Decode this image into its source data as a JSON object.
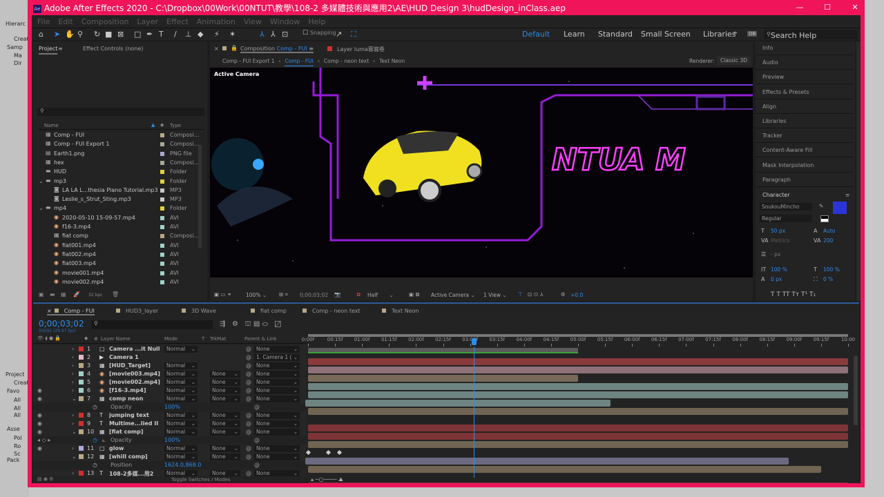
{
  "background_window": {
    "items": [
      "Hierarc",
      "Create",
      "Samp",
      "Ma",
      "Dir",
      "Project",
      "Create",
      "Favo",
      "All",
      "All",
      "All",
      "Asse",
      "Pol",
      "Ro",
      "Sc",
      "Pack"
    ]
  },
  "window": {
    "title": "Adobe After Effects 2020 - C:\\Dropbox\\00Work\\00NTUT\\教學\\108-2 多媒體技術與應用2\\AE\\HUD Design 3\\hudDesign_inClass.aep",
    "icon": "Ae",
    "minimize": "—",
    "maximize": "☐",
    "close": "✕"
  },
  "menu": [
    "File",
    "Edit",
    "Composition",
    "Layer",
    "Effect",
    "Animation",
    "View",
    "Window",
    "Help"
  ],
  "toolbar": {
    "snapping": "Snapping",
    "workspaces": [
      "Default",
      "Learn",
      "Standard",
      "Small Screen",
      "Libraries"
    ],
    "search_placeholder": "Search Help"
  },
  "project_panel": {
    "tabs": [
      "Project",
      "Effect Controls (none)"
    ],
    "columns": [
      "Name",
      "Type"
    ],
    "bpc": "32 bpc",
    "items": [
      {
        "name": "Comp - FUI",
        "type": "Composi...",
        "color": "#b8a888",
        "kind": "comp",
        "indent": 0
      },
      {
        "name": "Comp - FUI Export 1",
        "type": "Composi...",
        "color": "#a8a898",
        "kind": "comp",
        "indent": 0
      },
      {
        "name": "Earth1.png",
        "type": "PNG file",
        "color": "#a8a8d0",
        "kind": "file",
        "indent": 0
      },
      {
        "name": "hex",
        "type": "Composi...",
        "color": "#a8a898",
        "kind": "comp",
        "indent": 0
      },
      {
        "name": "HUD",
        "type": "Folder",
        "color": "#e0d040",
        "kind": "folder",
        "indent": 0
      },
      {
        "name": "mp3",
        "type": "Folder",
        "color": "#e0d040",
        "kind": "folder",
        "indent": 0
      },
      {
        "name": "LA LA L...thesia Piano Tutorial.mp3",
        "type": "MP3",
        "color": "#c8c8c8",
        "kind": "audio",
        "indent": 1
      },
      {
        "name": "Leslie_s_Strut_Sting.mp3",
        "type": "MP3",
        "color": "#c8c8c8",
        "kind": "audio",
        "indent": 1
      },
      {
        "name": "mp4",
        "type": "Folder",
        "color": "#e0d040",
        "kind": "folder",
        "indent": 0
      },
      {
        "name": "2020-05-10 15-09-57.mp4",
        "type": "AVI",
        "color": "#a0d0c8",
        "kind": "video",
        "indent": 1
      },
      {
        "name": "f16-3.mp4",
        "type": "AVI",
        "color": "#a0d0c8",
        "kind": "video",
        "indent": 1
      },
      {
        "name": "fiat comp",
        "type": "Composi...",
        "color": "#b8a888",
        "kind": "comp",
        "indent": 1
      },
      {
        "name": "fiat001.mp4",
        "type": "AVI",
        "color": "#a0d0c8",
        "kind": "video",
        "indent": 1
      },
      {
        "name": "fiat002.mp4",
        "type": "AVI",
        "color": "#a0d0c8",
        "kind": "video",
        "indent": 1
      },
      {
        "name": "fiat003.mp4",
        "type": "AVI",
        "color": "#a0d0c8",
        "kind": "video",
        "indent": 1
      },
      {
        "name": "movie001.mp4",
        "type": "AVI",
        "color": "#a0d0c8",
        "kind": "video",
        "indent": 1
      },
      {
        "name": "movie002.mp4",
        "type": "AVI",
        "color": "#a0d0c8",
        "kind": "video",
        "indent": 1
      }
    ]
  },
  "composition": {
    "tab_prefix": "Composition",
    "tab_name": "Comp - FUI",
    "layer_tab": "Layer luma蓉窩卷",
    "breadcrumbs": [
      "Comp - FUI Export 1",
      "Comp - FUI",
      "Comp - neon text",
      "Text Neon"
    ],
    "renderer_label": "Renderer:",
    "renderer": "Classic 3D",
    "camera_label": "Active Camera",
    "neon_text": "NTUA M",
    "footer": {
      "zoom": "100%",
      "timecode": "0;00;03;02",
      "resolution": "Half",
      "camera": "Active Camera",
      "views": "1 View",
      "exposure": "+0.0"
    }
  },
  "right_panels": [
    "Info",
    "Audio",
    "Preview",
    "Effects & Presets",
    "Align",
    "Libraries",
    "Tracker",
    "Content-Aware Fill",
    "Mask Interpolation",
    "Paragraph"
  ],
  "character": {
    "title": "Character",
    "font": "SoukouMincho",
    "style": "Regular",
    "size": "50 px",
    "leading": "Auto",
    "kerning": "Metrics",
    "tracking": "200",
    "stroke": "- px",
    "vscale": "100 %",
    "hscale": "100 %",
    "baseline": "0 px",
    "tsume": "0 %",
    "fill_color": "#2a35d8"
  },
  "timeline": {
    "tabs": [
      {
        "label": "Comp - FUI",
        "color": "#b8a888"
      },
      {
        "label": "HUD3_layer",
        "color": "#b8a888"
      },
      {
        "label": "3D Wave",
        "color": "#b8a888"
      },
      {
        "label": "fiat comp",
        "color": "#b8a888"
      },
      {
        "label": "Comp - neon text",
        "color": "#b8a888"
      },
      {
        "label": "Text Neon",
        "color": "#b8a888"
      }
    ],
    "timecode": "0;00;03;02",
    "fps": "00092 (29.97 fps)",
    "current_time": 3.07,
    "work_area_end": 5.0,
    "duration": 10,
    "columns": {
      "num": "#",
      "name": "Layer Name",
      "mode": "Mode",
      "t": "T",
      "trkmat": "TrkMat",
      "parent": "Parent & Link"
    },
    "ticks": [
      "0:00f",
      "00:15f",
      "01:00f",
      "01:15f",
      "02:00f",
      "02:15f",
      "03:00f",
      "03:15f",
      "04:00f",
      "04:15f",
      "05:00f",
      "05:15f",
      "06:00f",
      "06:15f",
      "07:00f",
      "07:15f",
      "08:00f",
      "08:15f",
      "09:00f",
      "09:15f",
      "10:00"
    ],
    "toggle_label": "Toggle Switches / Modes",
    "rows": [
      {
        "type": "layer",
        "num": "1",
        "name": "Camera ...it Null",
        "label": "#d03030",
        "mode": "Normal",
        "trkmat": "",
        "parent": "None",
        "eye": false,
        "open": false,
        "kind": "null",
        "start": 0,
        "end": 10,
        "bar": "#8a3a3c"
      },
      {
        "type": "layer",
        "num": "2",
        "name": "Camera 1",
        "label": "#e8b8c8",
        "mode": "",
        "trkmat": "",
        "parent": "1. Camera 1 (",
        "eye": false,
        "open": false,
        "kind": "camera",
        "start": 0,
        "end": 10,
        "bar": "#8e7078"
      },
      {
        "type": "layer",
        "num": "3",
        "name": "[HUD_Target]",
        "label": "#b8a888",
        "mode": "Normal",
        "trkmat": "",
        "parent": "None",
        "eye": false,
        "open": false,
        "kind": "comp",
        "start": 0,
        "end": 5,
        "bar": "#776a58"
      },
      {
        "type": "layer",
        "num": "4",
        "name": "[movie003.mp4]",
        "label": "#a0d0c8",
        "mode": "Normal",
        "trkmat": "None",
        "parent": "None",
        "eye": false,
        "open": false,
        "kind": "video",
        "start": 0,
        "end": 10,
        "bar": "#6e8482"
      },
      {
        "type": "layer",
        "num": "5",
        "name": "[movie002.mp4]",
        "label": "#a0d0c8",
        "mode": "Normal",
        "trkmat": "None",
        "parent": "None",
        "eye": false,
        "open": false,
        "kind": "video",
        "start": 0,
        "end": 10,
        "bar": "#6e8482"
      },
      {
        "type": "layer",
        "num": "6",
        "name": "[f16-3.mp4]",
        "label": "#a0d0c8",
        "mode": "Normal",
        "trkmat": "None",
        "parent": "None",
        "eye": true,
        "open": false,
        "kind": "video",
        "start": -0.1,
        "end": 5.6,
        "bar": "#6e8482"
      },
      {
        "type": "layer",
        "num": "7",
        "name": "comp neon",
        "label": "#b8a888",
        "mode": "Normal",
        "trkmat": "None",
        "parent": "None",
        "eye": true,
        "open": true,
        "kind": "comp",
        "start": 0,
        "end": 10,
        "bar": "#706452"
      },
      {
        "type": "prop",
        "name": "Opacity",
        "value": "100%",
        "keyframes": []
      },
      {
        "type": "layer",
        "num": "8",
        "name": "jumping text",
        "label": "#d03030",
        "mode": "Normal",
        "trkmat": "None",
        "parent": "None",
        "eye": true,
        "open": false,
        "kind": "text",
        "start": 0,
        "end": 10,
        "bar": "#7e3436"
      },
      {
        "type": "layer",
        "num": "9",
        "name": "Multime...lied II",
        "label": "#d03030",
        "mode": "Normal",
        "trkmat": "None",
        "parent": "None",
        "eye": true,
        "open": false,
        "kind": "text",
        "start": 0,
        "end": 10,
        "bar": "#7e3436"
      },
      {
        "type": "layer",
        "num": "10",
        "name": "[fiat comp]",
        "label": "#b8a888",
        "mode": "Normal",
        "trkmat": "None",
        "parent": "None",
        "eye": true,
        "open": true,
        "kind": "comp",
        "start": 0,
        "end": 10,
        "bar": "#706452"
      },
      {
        "type": "prop",
        "name": "Opacity",
        "value": "100%",
        "keyframes": [
          0,
          0.37,
          0.57
        ]
      },
      {
        "type": "layer",
        "num": "11",
        "name": "glow",
        "label": "#b0a8d8",
        "mode": "Normal",
        "trkmat": "None",
        "parent": "None",
        "eye": true,
        "open": false,
        "kind": "null",
        "start": -0.1,
        "end": 8.9,
        "bar": "#6c6a80"
      },
      {
        "type": "layer",
        "num": "12",
        "name": "[whill comp]",
        "label": "#b8a888",
        "mode": "Normal",
        "trkmat": "None",
        "parent": "None",
        "eye": false,
        "open": true,
        "kind": "comp",
        "start": 0,
        "end": 9.5,
        "bar": "#706452"
      },
      {
        "type": "prop",
        "name": "Position",
        "value": "1624.0,868.0",
        "keyframes": []
      },
      {
        "type": "layer",
        "num": "13",
        "name": "108-2多媒...用2",
        "label": "#d03030",
        "mode": "Normal",
        "trkmat": "None",
        "parent": "None",
        "eye": false,
        "open": false,
        "kind": "text",
        "start": 0,
        "end": 10,
        "bar": "#7e3436"
      }
    ]
  }
}
